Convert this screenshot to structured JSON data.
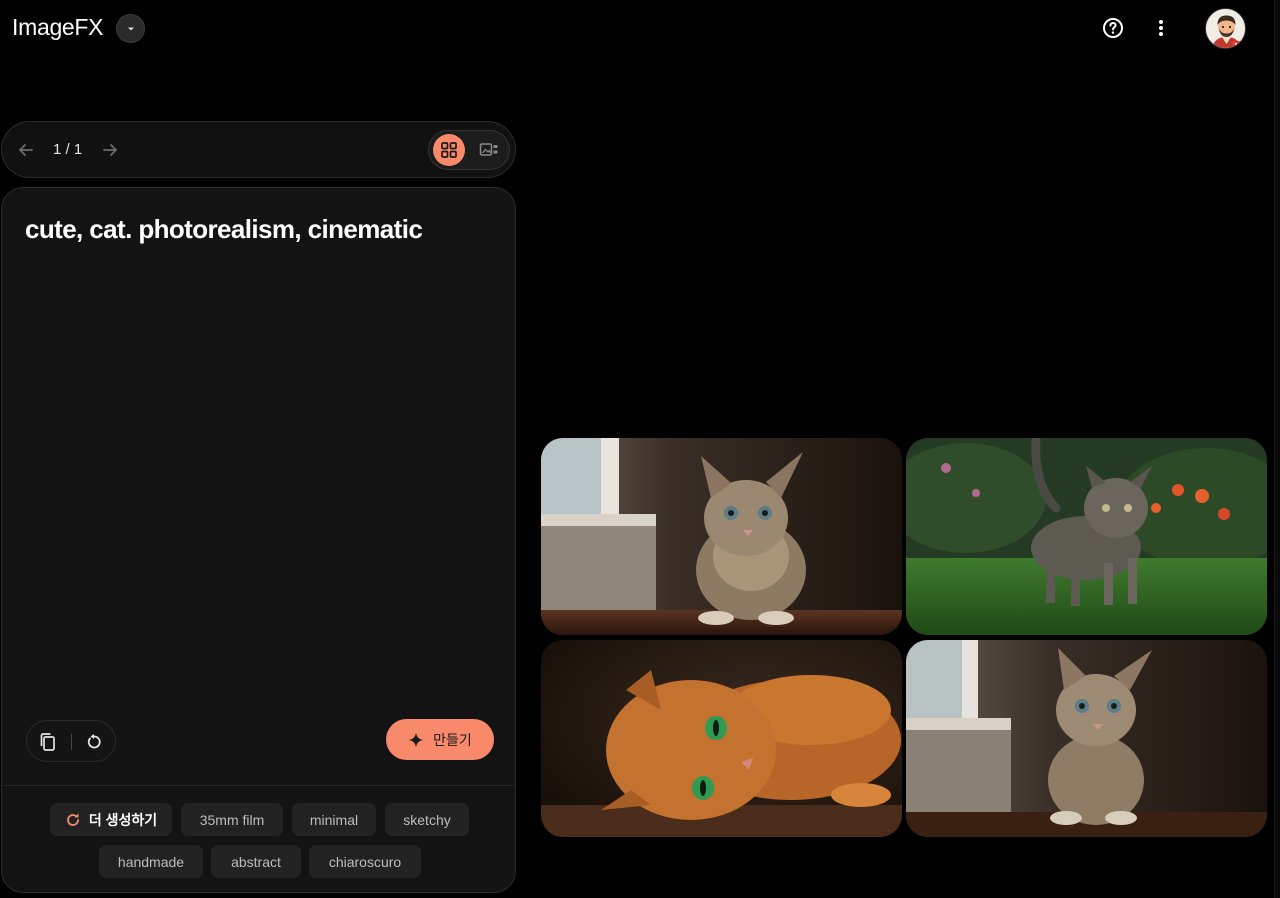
{
  "app": {
    "title": "ImageFX"
  },
  "header": {
    "icons": [
      "help-circle-icon",
      "more-vert-icon"
    ],
    "avatar": "user-avatar"
  },
  "pager": {
    "count": "1 / 1",
    "prev_icon": "arrow-left-icon",
    "next_icon": "arrow-right-icon",
    "views": [
      {
        "name": "grid-view-icon",
        "selected": true
      },
      {
        "name": "single-view-icon",
        "selected": false
      }
    ]
  },
  "prompt": {
    "text": "cute, cat. photorealism, cinematic"
  },
  "actions": {
    "create_label": "만들기",
    "copy_icon": "copy-icon",
    "reset_icon": "reset-icon"
  },
  "chips": {
    "more_label": "더 생성하기",
    "items": [
      "35mm film",
      "minimal",
      "sketchy",
      "handmade",
      "abstract",
      "chiaroscuro"
    ]
  },
  "images": [
    {
      "name": "tabby-kitten-window-image"
    },
    {
      "name": "tabby-kitten-grass-image"
    },
    {
      "name": "orange-cat-lying-image"
    },
    {
      "name": "tabby-kitten-floor-image"
    }
  ],
  "colors": {
    "accent": "#f8896a",
    "background": "#000000",
    "panel": "#131313",
    "chip": "#222222"
  }
}
